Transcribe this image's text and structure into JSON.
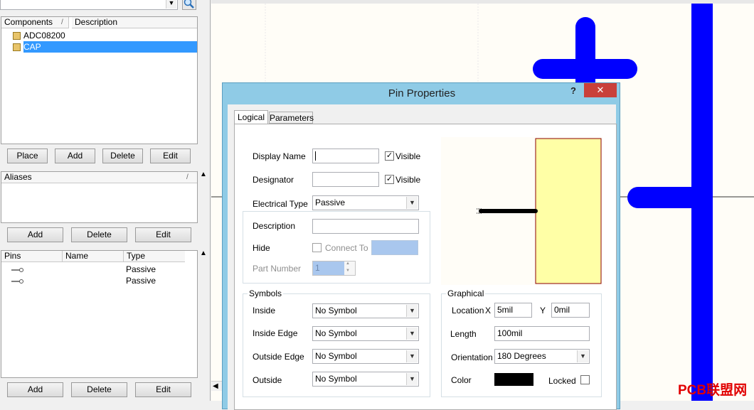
{
  "left": {
    "components": {
      "headers": [
        "Components",
        "/",
        "Description"
      ],
      "items": [
        "ADC08200",
        "CAP"
      ],
      "buttons": [
        "Place",
        "Add",
        "Delete",
        "Edit"
      ]
    },
    "aliases": {
      "header": "Aliases",
      "sort_mark": "/",
      "buttons": [
        "Add",
        "Delete",
        "Edit"
      ]
    },
    "pins": {
      "headers": [
        "Pins",
        "Name",
        "Type"
      ],
      "rows": [
        {
          "type": "Passive"
        },
        {
          "type": "Passive"
        }
      ],
      "buttons": [
        "Add",
        "Delete",
        "Edit"
      ]
    }
  },
  "dialog": {
    "title": "Pin Properties",
    "help": "?",
    "close": "✕",
    "tabs": [
      "Logical",
      "Parameters"
    ],
    "fields": {
      "display_name": {
        "label": "Display Name",
        "value": "",
        "visible_label": "Visible"
      },
      "designator": {
        "label": "Designator",
        "value": "",
        "visible_label": "Visible"
      },
      "electrical_type": {
        "label": "Electrical Type",
        "value": "Passive"
      },
      "description": {
        "label": "Description",
        "value": ""
      },
      "hide": {
        "label": "Hide",
        "connect_to_label": "Connect To"
      },
      "part_number": {
        "label": "Part Number",
        "value": "1"
      }
    },
    "symbols": {
      "title": "Symbols",
      "rows": [
        {
          "label": "Inside",
          "value": "No Symbol"
        },
        {
          "label": "Inside Edge",
          "value": "No Symbol"
        },
        {
          "label": "Outside Edge",
          "value": "No Symbol"
        },
        {
          "label": "Outside",
          "value": "No Symbol"
        }
      ]
    },
    "graphical": {
      "title": "Graphical",
      "location_label": "Location",
      "x_label": "X",
      "x_value": "5mil",
      "y_label": "Y",
      "y_value": "0mil",
      "length_label": "Length",
      "length_value": "100mil",
      "orientation_label": "Orientation",
      "orientation_value": "180 Degrees",
      "color_label": "Color",
      "locked_label": "Locked",
      "pin_color": "#000000"
    }
  },
  "watermark": "PCB联盟网",
  "colors": {
    "accent_blue": "#0000ff",
    "selection": "#3399ff",
    "title_bar": "#8fcbe6",
    "close_button": "#c9403a",
    "preview_body": "#ffffa6",
    "preview_border": "#8b0000",
    "watermark": "#e10000"
  }
}
